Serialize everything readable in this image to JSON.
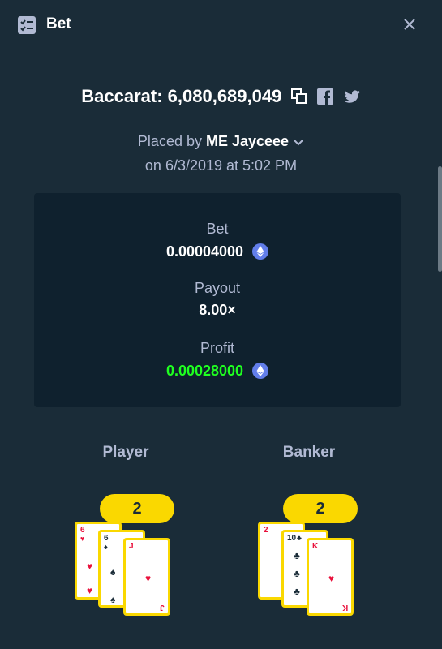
{
  "header": {
    "title": "Bet",
    "icon": "bet-list-icon",
    "close_icon": "close-icon"
  },
  "bet": {
    "game_label": "Baccarat: 6,080,689,049",
    "placed_by_prefix": "Placed by ",
    "user": "ME Jayceee",
    "on_label": "on 6/3/2019 at 5:02 PM"
  },
  "stats": {
    "bet_label": "Bet",
    "bet_value": "0.00004000",
    "payout_label": "Payout",
    "payout_value": "8.00×",
    "profit_label": "Profit",
    "profit_value": "0.00028000",
    "profit_color": "#1fff20",
    "currency_icon": "ethereum-icon"
  },
  "player": {
    "label": "Player",
    "score": "2",
    "cards": [
      {
        "rank": "6",
        "suit": "♥",
        "color": "red"
      },
      {
        "rank": "6",
        "suit": "♠",
        "color": "black"
      },
      {
        "rank": "J",
        "suit": "♥",
        "color": "red"
      }
    ]
  },
  "banker": {
    "label": "Banker",
    "score": "2",
    "cards": [
      {
        "rank": "2",
        "suit": "♥",
        "color": "red"
      },
      {
        "rank": "10",
        "suit": "♣",
        "color": "black"
      },
      {
        "rank": "K",
        "suit": "♥",
        "color": "red"
      }
    ]
  },
  "colors": {
    "background": "#1a2c38",
    "panel": "#0f212e",
    "accent": "#fad800",
    "muted": "#b1bad3"
  }
}
